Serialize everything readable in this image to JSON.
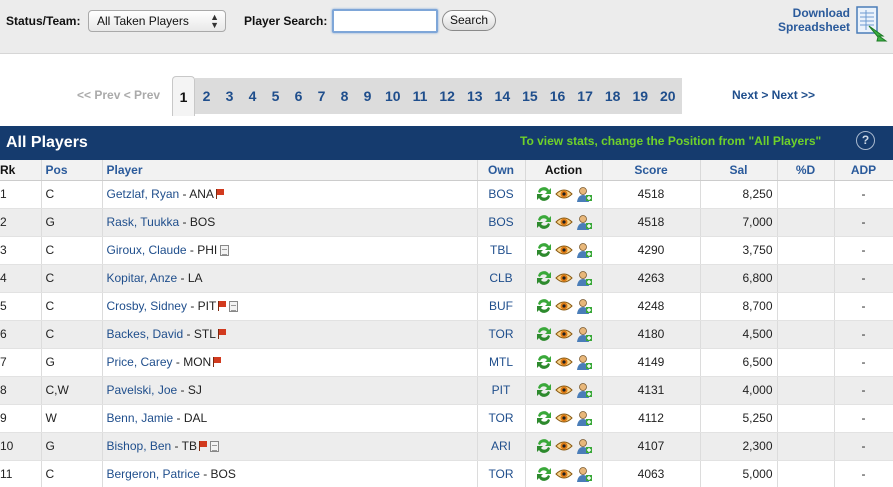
{
  "filters": {
    "status_label": "Status/Team:",
    "status_value": "All Taken Players",
    "search_label": "Player Search:",
    "search_value": "",
    "search_button": "Search",
    "download_line1": "Download",
    "download_line2": "Spreadsheet"
  },
  "pagination": {
    "prev": "<< Prev < Prev",
    "pages": [
      "1",
      "2",
      "3",
      "4",
      "5",
      "6",
      "7",
      "8",
      "9",
      "10",
      "11",
      "12",
      "13",
      "14",
      "15",
      "16",
      "17",
      "18",
      "19",
      "20"
    ],
    "current": "1",
    "next": "Next > Next >>"
  },
  "section": {
    "title": "All Players",
    "hint": "To view stats, change the Position from \"All Players\"",
    "help": "?"
  },
  "table": {
    "headers": {
      "rk": "Rk",
      "pos": "Pos",
      "player": "Player",
      "own": "Own",
      "action": "Action",
      "score": "Score",
      "sal": "Sal",
      "pd": "%D",
      "adp": "ADP"
    },
    "rows": [
      {
        "rk": "1",
        "pos": "C",
        "name": "Getzlaf, Ryan",
        "team": " - ANA",
        "flag": true,
        "note": false,
        "own": "BOS",
        "score": "4518",
        "sal": "8,250",
        "pd": "",
        "adp": "-"
      },
      {
        "rk": "2",
        "pos": "G",
        "name": "Rask, Tuukka",
        "team": " - BOS",
        "flag": false,
        "note": false,
        "own": "BOS",
        "score": "4518",
        "sal": "7,000",
        "pd": "",
        "adp": "-"
      },
      {
        "rk": "3",
        "pos": "C",
        "name": "Giroux, Claude",
        "team": " - PHI",
        "flag": false,
        "note": true,
        "own": "TBL",
        "score": "4290",
        "sal": "3,750",
        "pd": "",
        "adp": "-"
      },
      {
        "rk": "4",
        "pos": "C",
        "name": "Kopitar, Anze",
        "team": " - LA",
        "flag": false,
        "note": false,
        "own": "CLB",
        "score": "4263",
        "sal": "6,800",
        "pd": "",
        "adp": "-"
      },
      {
        "rk": "5",
        "pos": "C",
        "name": "Crosby, Sidney",
        "team": " - PIT",
        "flag": true,
        "note": true,
        "own": "BUF",
        "score": "4248",
        "sal": "8,700",
        "pd": "",
        "adp": "-"
      },
      {
        "rk": "6",
        "pos": "C",
        "name": "Backes, David",
        "team": " - STL",
        "flag": true,
        "note": false,
        "own": "TOR",
        "score": "4180",
        "sal": "4,500",
        "pd": "",
        "adp": "-"
      },
      {
        "rk": "7",
        "pos": "G",
        "name": "Price, Carey",
        "team": " - MON",
        "flag": true,
        "note": false,
        "own": "MTL",
        "score": "4149",
        "sal": "6,500",
        "pd": "",
        "adp": "-"
      },
      {
        "rk": "8",
        "pos": "C,W",
        "name": "Pavelski, Joe",
        "team": " - SJ",
        "flag": false,
        "note": false,
        "own": "PIT",
        "score": "4131",
        "sal": "4,000",
        "pd": "",
        "adp": "-"
      },
      {
        "rk": "9",
        "pos": "W",
        "name": "Benn, Jamie",
        "team": " - DAL",
        "flag": false,
        "note": false,
        "own": "TOR",
        "score": "4112",
        "sal": "5,250",
        "pd": "",
        "adp": "-"
      },
      {
        "rk": "10",
        "pos": "G",
        "name": "Bishop, Ben",
        "team": " - TB",
        "flag": true,
        "note": true,
        "own": "ARI",
        "score": "4107",
        "sal": "2,300",
        "pd": "",
        "adp": "-"
      },
      {
        "rk": "11",
        "pos": "C",
        "name": "Bergeron, Patrice",
        "team": " - BOS",
        "flag": false,
        "note": false,
        "own": "TOR",
        "score": "4063",
        "sal": "5,000",
        "pd": "",
        "adp": "-"
      }
    ]
  },
  "icons": {
    "trade": "trade-arrows-icon",
    "watch": "watch-eye-icon",
    "claim": "claim-player-icon",
    "flag": "injury-flag-icon",
    "note": "news-note-icon",
    "download": "spreadsheet-download-icon",
    "help": "help-icon"
  },
  "colors": {
    "header_bg": "#153b6e",
    "hint_green": "#6fd12a",
    "link_blue": "#1f4e8c",
    "row_alt": "#ededed"
  }
}
